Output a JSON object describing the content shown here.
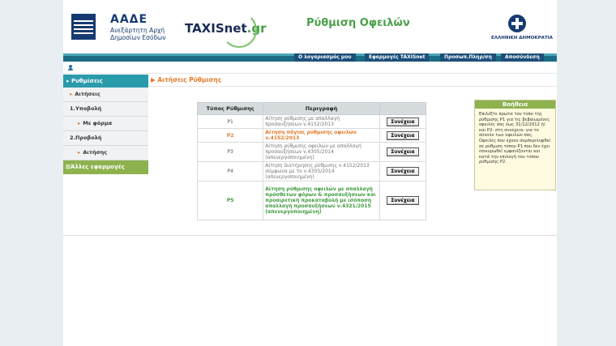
{
  "header": {
    "org_name": "ΑΑΔΕ",
    "org_subtitle": "Ανεξάρτητη Αρχή Δημοσίων Εσόδων",
    "brand_main": "TAXISnet",
    "brand_suffix": ".gr",
    "page_title": "Ρύθμιση Οφειλών",
    "gov_label": "ΕΛΛΗΝΙΚΗ ΔΗΜΟΚΡΑΤΙΑ"
  },
  "nav": {
    "items": [
      {
        "label": "Ο λογαριασμός μου"
      },
      {
        "label": "Εφαρμογές TAXISnet"
      },
      {
        "label": "Προσωπ.Πληρ/ση"
      },
      {
        "label": "Αποσύνδεση"
      }
    ]
  },
  "sidebar": {
    "header": "Ρυθμίσεις",
    "items": [
      {
        "label": "Αιτήσεις"
      },
      {
        "label": "1.Υποβολή"
      },
      {
        "label": "Με φόρμα"
      },
      {
        "label": "2.Προβολή"
      },
      {
        "label": "Αιτήσης"
      }
    ],
    "footer": "Άλλες εφαρμογές"
  },
  "breadcrumb": "Αιτήσεις Ρύθμισης",
  "table": {
    "headers": [
      "Τύπος Ρύθμισης",
      "Περιγραφή"
    ],
    "action_label": "Συνέχεια",
    "rows": [
      {
        "type": "P1",
        "desc": "Αίτηση ρύθμισης με απαλλαγή προσαυξήσεων ν.4152/2013"
      },
      {
        "type": "P2",
        "desc": "Αίτηση πάγιας ρύθμισης οφειλών ν.4152/2013"
      },
      {
        "type": "P3",
        "desc": "Αίτηση ρύθμισης οφειλών με απαλλαγή προσαυξήσεων ν.4305/2014 (απενεργοποιημένη)"
      },
      {
        "type": "P4",
        "desc": "Αίτηση διατήρησης ρύθμισης ν.4152/2013 σύμφωνα με το ν.4305/2014 (απενεργοποιημένη)"
      },
      {
        "type": "P5",
        "desc": "Αίτηση ρύθμισης οφειλών με απαλλαγή πρόσθετων φόρων & προσαυξήσεων και προαιρετική προκαταβολή με ισόποση απαλλαγή προσαυξήσεων ν.4321/2015 (απενεργοποιημένη)"
      }
    ]
  },
  "help": {
    "title": "Βοήθεια",
    "text": "Επιλέξτε πρώτα τον τύπο της ρύθμισης P1 για τις βεβαιωμένες οφειλές σας έως 31/12/2012 ή/και P2- στη συνέχεια- για το σύνολο των οφειλών σας. Οφειλές που έχουν συμπεριληφθεί σε ρύθμιση τύπου P1 που δεν έχει επικυρωθεί εμφανίζονται και κατά την επιλογή του τύπου ρύθμισης P2."
  },
  "colors": {
    "accent_orange": "#e07a2a",
    "accent_green": "#3e9a3e",
    "nav_teal": "#1c6c84",
    "sidebar_green": "#8db24e"
  }
}
